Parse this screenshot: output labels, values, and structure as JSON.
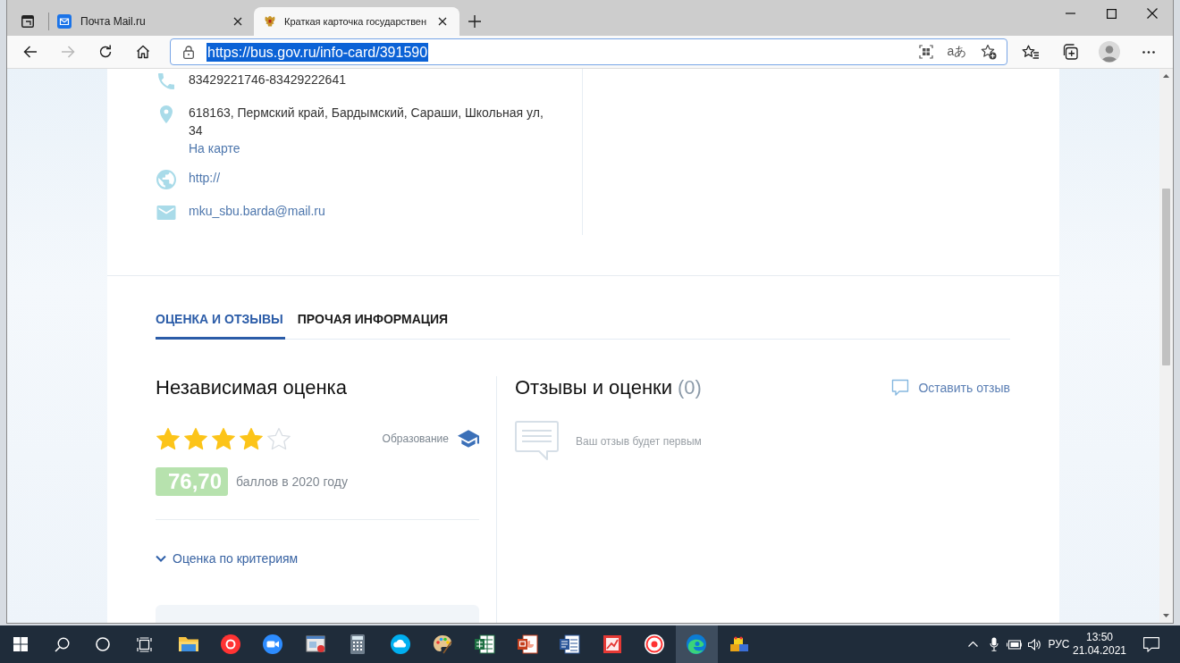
{
  "browser": {
    "tabs": [
      {
        "kind": "mail",
        "title": "Почта Mail.ru",
        "selected": false
      },
      {
        "kind": "crest",
        "title": "Краткая карточка государствен",
        "selected": true
      }
    ],
    "forward_disabled": true,
    "address_bar": {
      "url": "https://bus.gov.ru/info-card/391590",
      "url_selected": true,
      "translate_glyph": "aあ"
    }
  },
  "contacts": [
    {
      "kind": "phone",
      "text": "83429221746-83429222641"
    },
    {
      "kind": "address",
      "text": "618163, Пермский край, Бардымский, Сараши, Школьная ул, 34",
      "map_link": "На карте"
    },
    {
      "kind": "website",
      "text": "http://"
    },
    {
      "kind": "email",
      "text": "mku_sbu.barda@mail.ru"
    }
  ],
  "section_tabs": [
    {
      "label": "ОЦЕНКА И ОТЗЫВЫ",
      "selected": true
    },
    {
      "label": "ПРОЧАЯ ИНФОРМАЦИЯ",
      "selected": false
    }
  ],
  "independent_rating": {
    "title": "Независимая оценка",
    "stars": 4,
    "category": "Образование",
    "score": "76,70",
    "score_caption": "баллов в 2020 году",
    "criteria_link": "Оценка по критериям",
    "criteria_expanded": false
  },
  "reviews": {
    "title": "Отзывы и оценки",
    "count": "(0)",
    "action": "Оставить отзыв",
    "empty_text": "Ваш отзыв будет первым"
  },
  "taskbar": {
    "apps": [
      {
        "kind": "folder",
        "selected": false
      },
      {
        "kind": "circle_red",
        "selected": false
      },
      {
        "kind": "camera",
        "selected": false
      },
      {
        "kind": "window",
        "selected": false
      },
      {
        "kind": "calculator",
        "selected": false
      },
      {
        "kind": "circle_blue",
        "selected": false
      },
      {
        "kind": "palette",
        "selected": false
      },
      {
        "kind": "sheet",
        "selected": false
      },
      {
        "kind": "slides",
        "selected": false
      },
      {
        "kind": "doc",
        "selected": false
      },
      {
        "kind": "tile",
        "selected": false
      },
      {
        "kind": "circle_white",
        "selected": false
      },
      {
        "kind": "edge",
        "selected": true
      },
      {
        "kind": "blocks",
        "selected": false
      }
    ],
    "language": "РУС",
    "time": "13:50",
    "date": "21.04.2021"
  }
}
